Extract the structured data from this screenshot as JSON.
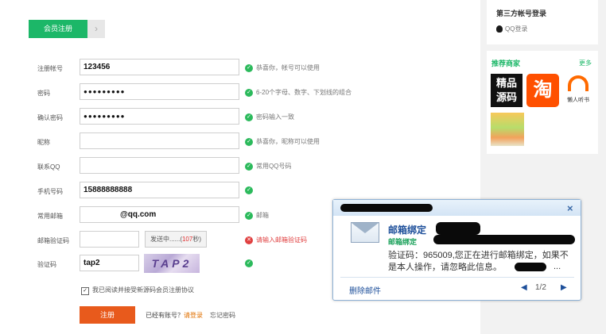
{
  "tabs": {
    "active": "会员注册",
    "arrow": "›"
  },
  "form": {
    "rows": [
      {
        "label": "注册帐号",
        "value": "123456",
        "hint": "恭喜你，帐号可以使用",
        "status": "ok"
      },
      {
        "label": "密码",
        "value": "●●●●●●●●●",
        "hint": "6-20个字母、数字、下划线的组合",
        "status": "ok"
      },
      {
        "label": "确认密码",
        "value": "●●●●●●●●●",
        "hint": "密码输入一致",
        "status": "ok"
      },
      {
        "label": "昵称",
        "value": "",
        "hint": "恭喜你，昵称可以使用",
        "status": "ok"
      },
      {
        "label": "联系QQ",
        "value": "",
        "hint": "常用QQ号码",
        "status": "ok"
      },
      {
        "label": "手机号码",
        "value": "15888888888",
        "hint": "",
        "status": "ok"
      },
      {
        "label": "常用邮箱",
        "value": "@qq.com",
        "hint": "邮箱",
        "status": "ok"
      },
      {
        "label": "邮箱验证码",
        "value": "",
        "hint": "请输入邮箱验证码",
        "status": "error"
      },
      {
        "label": "验证码",
        "value": "tap2",
        "hint": "",
        "status": "ok"
      }
    ],
    "send_button": {
      "prefix": "发送中......(",
      "count": "107",
      "suffix": "秒)"
    },
    "captcha_text": "TAP2",
    "agree_text": "我已阅读并接受新源码会员注册协议",
    "register_label": "注册",
    "has_account": "已经有账号？",
    "login_link": "请登录",
    "forgot": "忘记密码"
  },
  "sidebar": {
    "third_party_title": "第三方帐号登录",
    "qq_login": "QQ登录",
    "recommend_title": "推荐商家",
    "more": "更多",
    "merchants": [
      {
        "name": "精品源码",
        "line1": "精品",
        "line2": "源码"
      },
      {
        "name": "淘",
        "glyph": "淘"
      },
      {
        "name": "懒人听书",
        "caption": "懒人听书"
      }
    ]
  },
  "notification": {
    "close": "×",
    "title": "邮箱绑定",
    "subtitle": "邮箱绑定",
    "body": "验证码：965009,您正在进行邮箱绑定，如果不是本人操作，请忽略此信息。",
    "ellipsis": "...",
    "delete_label": "删除邮件",
    "prev": "◀",
    "page": "1/2",
    "next": "▶"
  },
  "colors": {
    "accent": "#1cb768",
    "register": "#e85a1c",
    "error": "#e04040",
    "link": "#1d4f9a"
  }
}
